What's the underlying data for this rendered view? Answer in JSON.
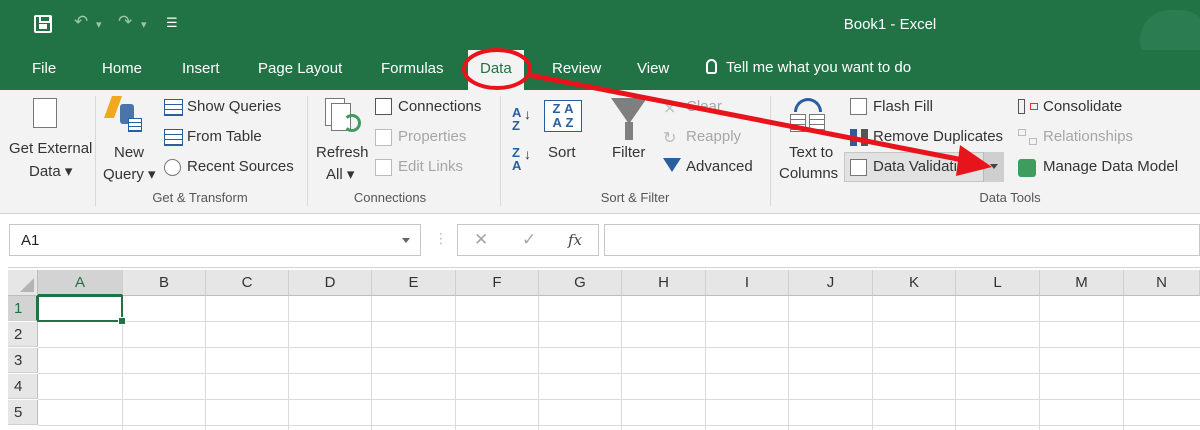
{
  "window": {
    "title": "Book1  -  Excel",
    "qat_undo_icon": "undo-icon",
    "qat_redo_icon": "redo-icon",
    "qat_customize_icon": "customize-qat-icon"
  },
  "tabs": [
    {
      "label": "File"
    },
    {
      "label": "Home"
    },
    {
      "label": "Insert"
    },
    {
      "label": "Page Layout"
    },
    {
      "label": "Formulas"
    },
    {
      "label": "Data",
      "active": true
    },
    {
      "label": "Review"
    },
    {
      "label": "View"
    }
  ],
  "tell_me": "Tell me what you want to do",
  "ribbon": {
    "get_external": {
      "line1": "Get External",
      "line2": "Data ▾"
    },
    "get_transform": {
      "new_query_1": "New",
      "new_query_2": "Query ▾",
      "show_queries": "Show Queries",
      "from_table": "From Table",
      "recent_sources": "Recent Sources",
      "group_label": "Get & Transform"
    },
    "connections": {
      "refresh_1": "Refresh",
      "refresh_2": "All ▾",
      "connections": "Connections",
      "properties": "Properties",
      "edit_links": "Edit Links",
      "group_label": "Connections"
    },
    "sort_filter": {
      "az": "A↓Z",
      "za": "Z↓A",
      "sort": "Sort",
      "filter": "Filter",
      "clear": "Clear",
      "reapply": "Reapply",
      "advanced": "Advanced",
      "group_label": "Sort & Filter"
    },
    "data_tools": {
      "text_to_1": "Text to",
      "text_to_2": "Columns",
      "flash_fill": "Flash Fill",
      "remove_duplicates": "Remove Duplicates",
      "data_validation": "Data Validation",
      "consolidate": "Consolidate",
      "relationships": "Relationships",
      "manage_data_model": "Manage Data Model",
      "group_label": "Data Tools"
    }
  },
  "formula_bar": {
    "name_box": "A1",
    "cancel": "✕",
    "enter": "✓",
    "fx": "fx",
    "formula": ""
  },
  "grid": {
    "columns": [
      "A",
      "B",
      "C",
      "D",
      "E",
      "F",
      "G",
      "H",
      "I",
      "J",
      "K",
      "L",
      "M",
      "N"
    ],
    "rows": [
      "1",
      "2",
      "3",
      "4",
      "5"
    ],
    "active_cell": "A1"
  },
  "colors": {
    "excel_green": "#217346",
    "annotation_red": "#e8141c"
  }
}
